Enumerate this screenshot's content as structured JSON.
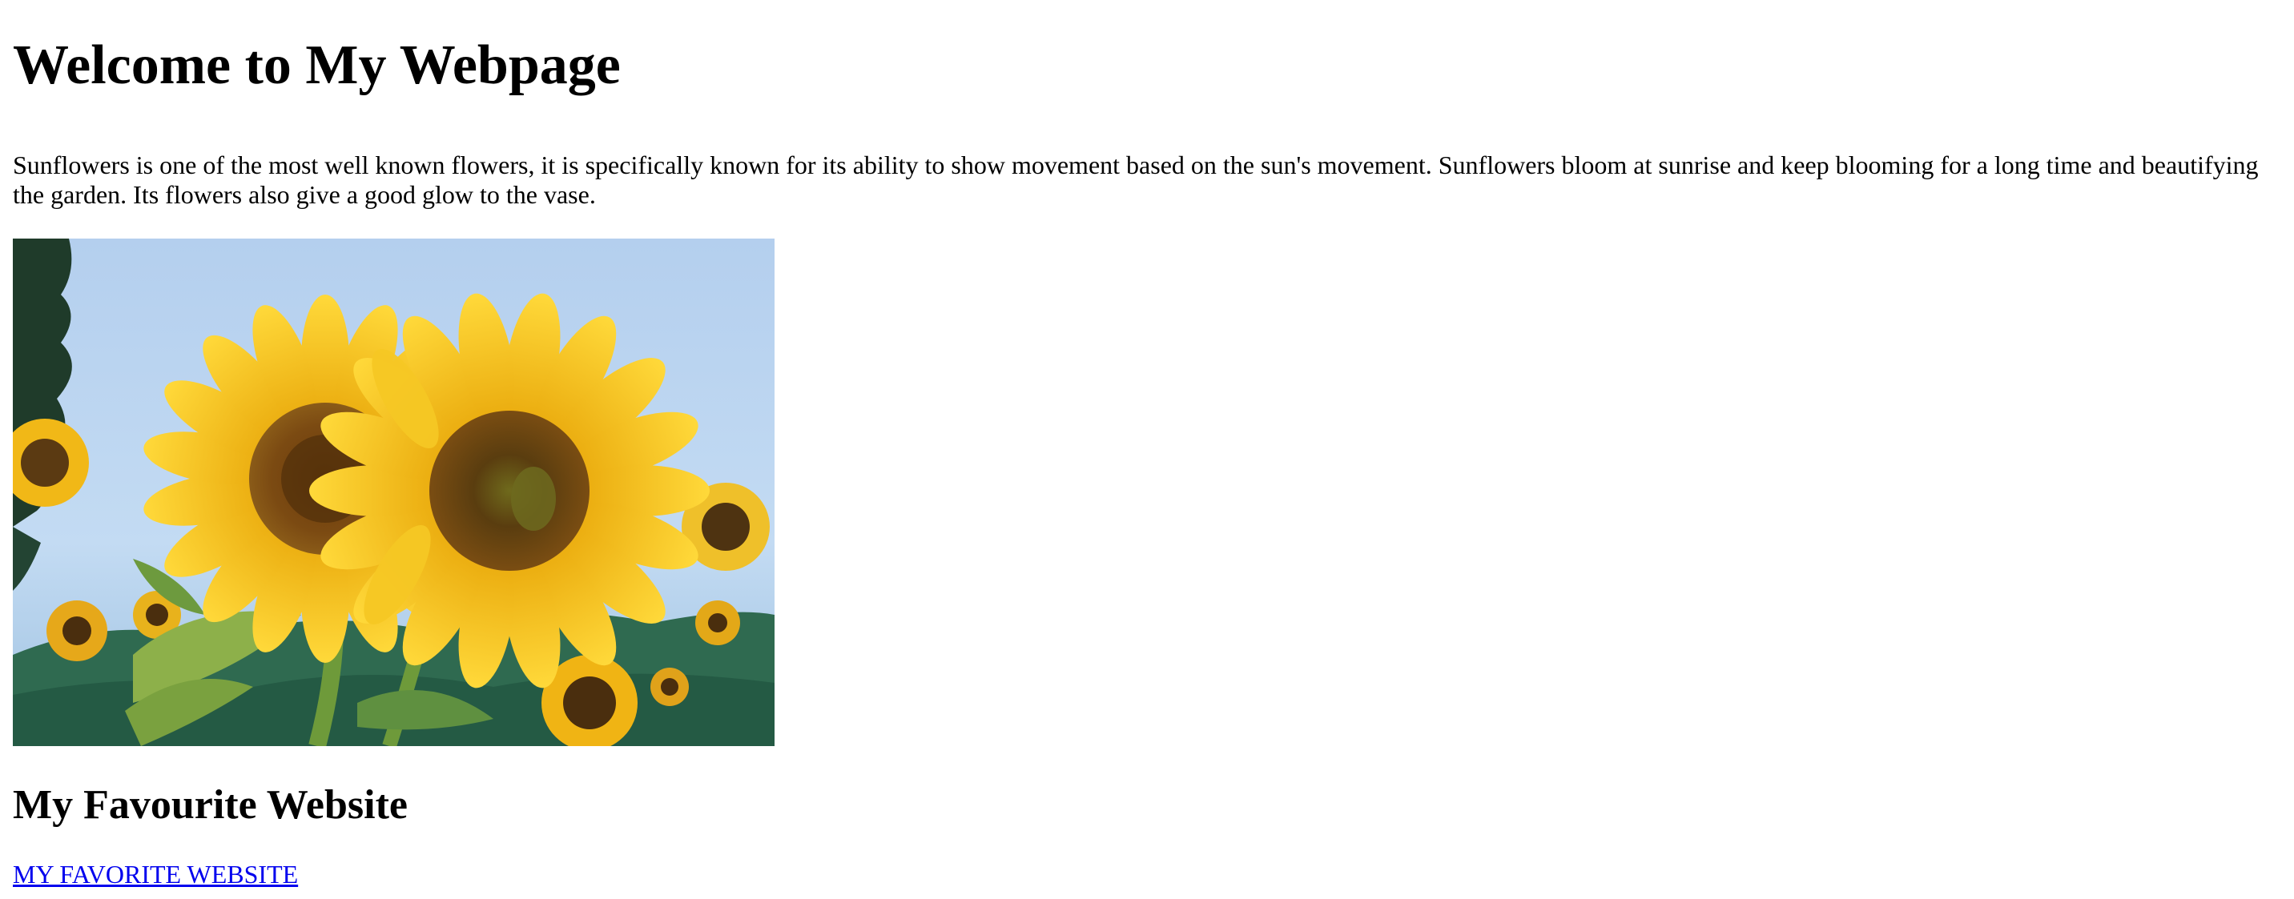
{
  "page": {
    "title": "Welcome to My Webpage",
    "intro": "Sunflowers is one of the most well known flowers, it is specifically known for its ability to show movement based on the sun's movement. Sunflowers bloom at sunrise and keep blooming for a long time and beautifying the garden. Its flowers also give a good glow to the vase.",
    "image_icon": "sunflower-photo",
    "section_title": "My Favourite Website",
    "link_text": "MY FAVORITE WEBSITE"
  },
  "colors": {
    "link": "#0000ee",
    "text": "#000000",
    "background": "#ffffff",
    "sky": "#b9d4ef",
    "petal": "#f5c518",
    "center": "#5a3d0f",
    "foliage": "#3f7a4a"
  }
}
